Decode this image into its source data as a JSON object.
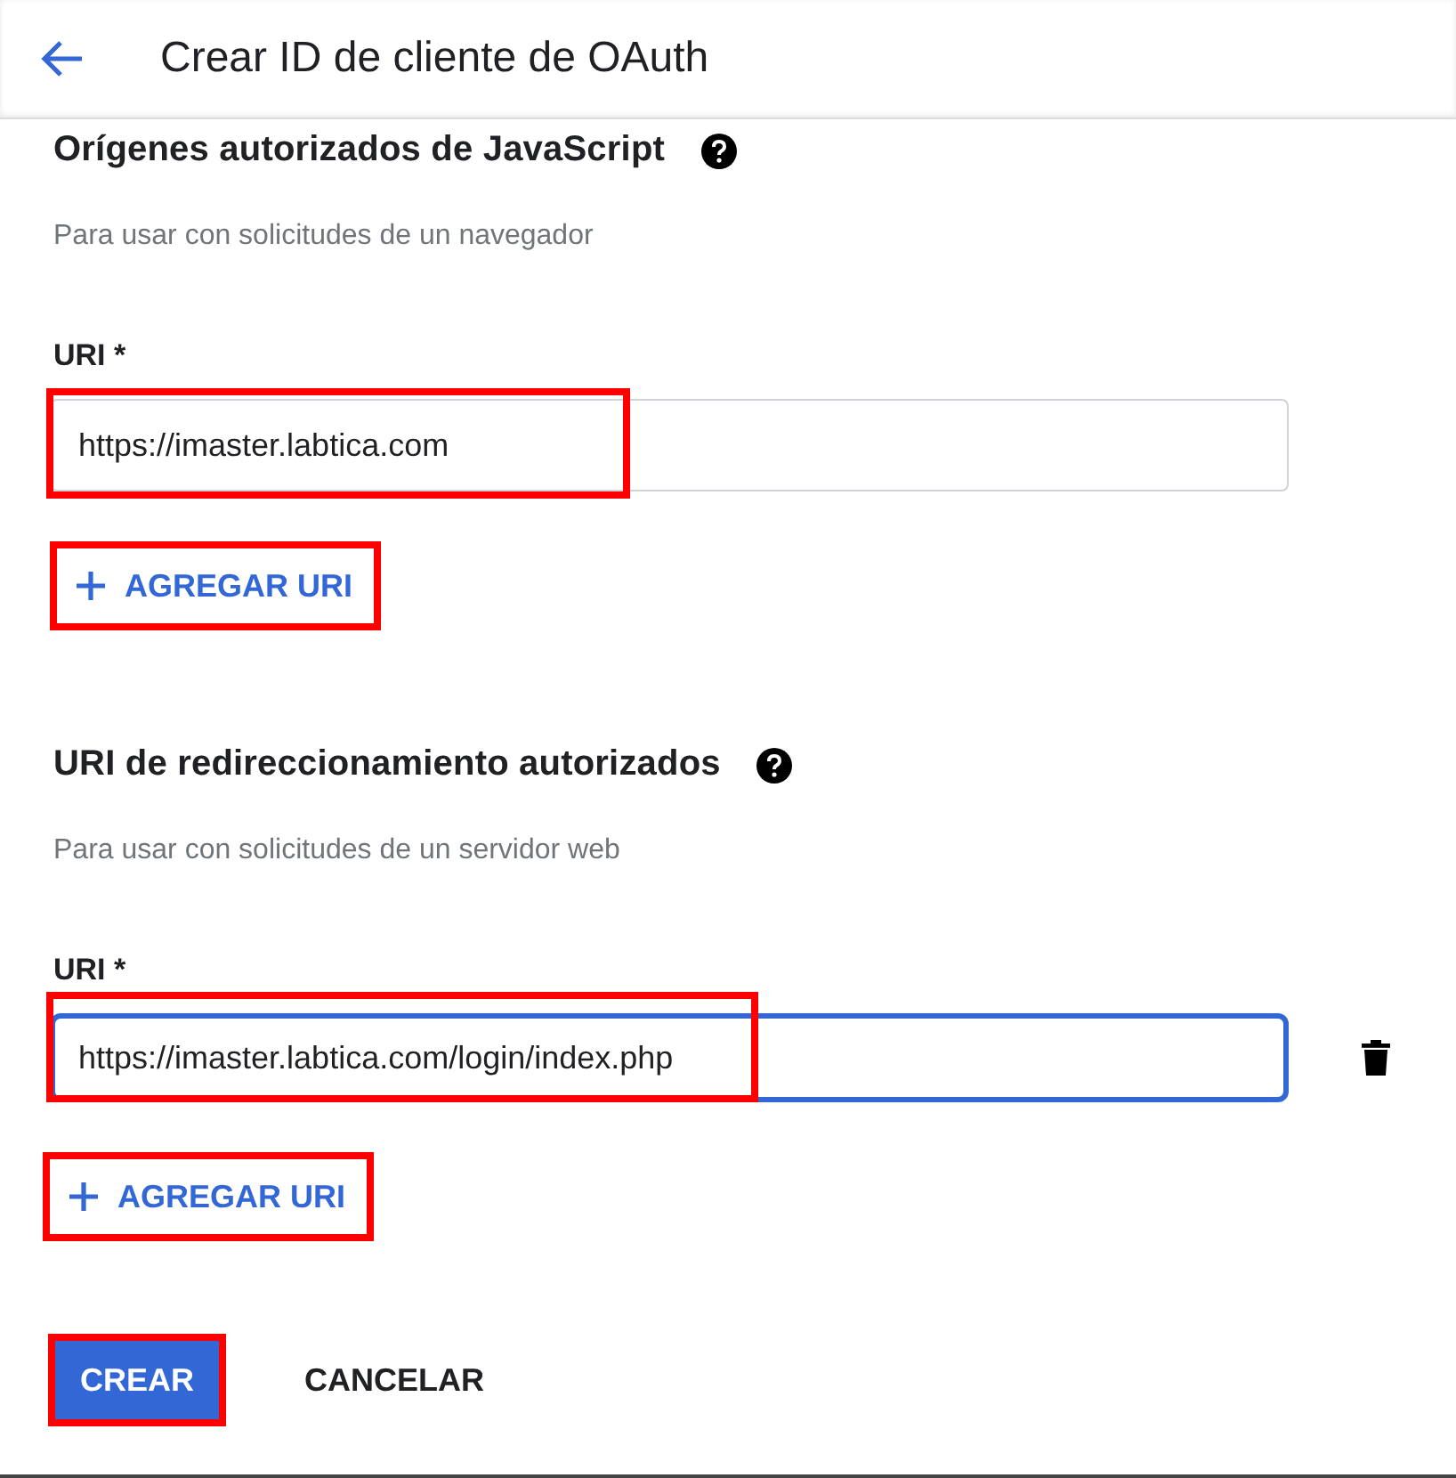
{
  "header": {
    "title": "Crear ID de cliente de OAuth"
  },
  "sections": [
    {
      "title": "Orígenes autorizados de JavaScript",
      "hint": "Para usar con solicitudes de un navegador",
      "label": "URI *",
      "value": "https://imaster.labtica.com",
      "focused": false,
      "highlighted": true,
      "deletable": false,
      "add_button": {
        "label": "AGREGAR URI",
        "highlighted": true
      }
    },
    {
      "title": "URI de redireccionamiento autorizados",
      "hint": "Para usar con solicitudes de un servidor web",
      "label": "URI *",
      "value": "https://imaster.labtica.com/login/index.php",
      "focused": true,
      "highlighted": true,
      "deletable": true,
      "add_button": {
        "label": "AGREGAR URI",
        "highlighted": true
      }
    }
  ],
  "actions": [
    {
      "label": "CREAR",
      "kind": "primary",
      "highlighted": true
    },
    {
      "label": "CANCELAR",
      "kind": "text",
      "highlighted": false
    }
  ]
}
